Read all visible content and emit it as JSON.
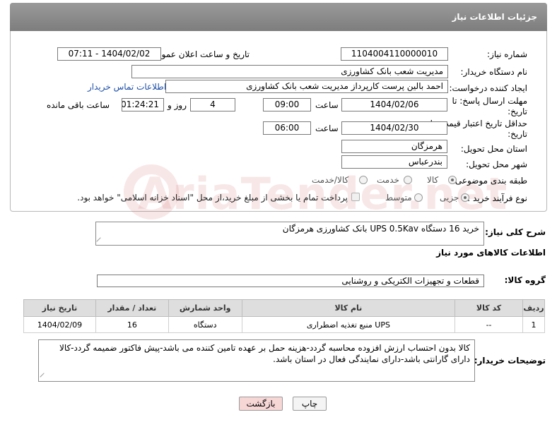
{
  "header": {
    "title": "جزئیات اطلاعات نیاز"
  },
  "fields": {
    "need_number_label": "شماره نیاز:",
    "need_number": "1104004110000010",
    "announce_label": "تاریخ و ساعت اعلان عمومی:",
    "announce_value": "1404/02/02 - 07:11",
    "buyer_org_label": "نام دستگاه خریدار:",
    "buyer_org": "مدیریت شعب بانک کشاورزی",
    "creator_label": "ایجاد کننده درخواست:",
    "creator": "احمد بالین پرست  کارپرداز مدیریت شعب بانک کشاورزی",
    "contact_link": "اطلاعات تماس خریدار",
    "deadline_label": "مهلت ارسال پاسخ: تا تاریخ:",
    "deadline_date": "1404/02/06",
    "time_label": "ساعت",
    "deadline_time": "09:00",
    "days_value": "4",
    "days_label": "روز و",
    "remaining_value": "01:24:21",
    "remaining_label": "ساعت باقی مانده",
    "validity_label": "حداقل تاریخ اعتبار قیمت: تا تاریخ:",
    "validity_date": "1404/02/30",
    "validity_time_label": "ساعت",
    "validity_time": "06:00",
    "province_label": "استان محل تحویل:",
    "province": "هرمزگان",
    "city_label": "شهر محل تحویل:",
    "city": "بندرعباس",
    "category_label": "طبقه بندی موضوعی:",
    "category_goods": "کالا",
    "category_service": "خدمت",
    "category_both": "کالا/خدمت",
    "process_label": "نوع فرآیند خرید :",
    "process_small": "جزیی",
    "process_medium": "متوسط",
    "payment_note": "پرداخت تمام یا بخشی از مبلغ خرید،از محل \"اسناد خزانه اسلامی\" خواهد بود."
  },
  "description": {
    "label": "شرح کلی نیاز:",
    "value": "خرید 16 دستگاه UPS 0.5Kav بانک کشاورزی هرمزگان"
  },
  "goods_section": {
    "title": "اطلاعات کالاهای مورد نیاز",
    "group_label": "گروه کالا:",
    "group_value": "قطعات و تجهیزات الکتریکی و روشنایی"
  },
  "table": {
    "headers": [
      "ردیف",
      "کد کالا",
      "نام کالا",
      "واحد شمارش",
      "تعداد / مقدار",
      "تاریخ نیاز"
    ],
    "rows": [
      [
        "1",
        "--",
        "منبع تغذیه اضطراری UPS",
        "دستگاه",
        "16",
        "1404/02/09"
      ]
    ]
  },
  "notes": {
    "label": "توضیحات خریدار:",
    "value": "کالا بدون احتساب ارزش افزوده محاسبه گردد-هزینه حمل بر عهده تامین کننده می باشد-پیش فاکتور ضمیمه گردد-کالا دارای گارانتی باشد-دارای نمایندگی فعال در استان باشد."
  },
  "buttons": {
    "print": "چاپ",
    "back": "بازگشت"
  },
  "watermark": "AriaTender.net",
  "colors": {
    "header_bg": "#8a8a8a",
    "link": "#1d4fa8",
    "back_button_bg": "#f7d6d6"
  }
}
